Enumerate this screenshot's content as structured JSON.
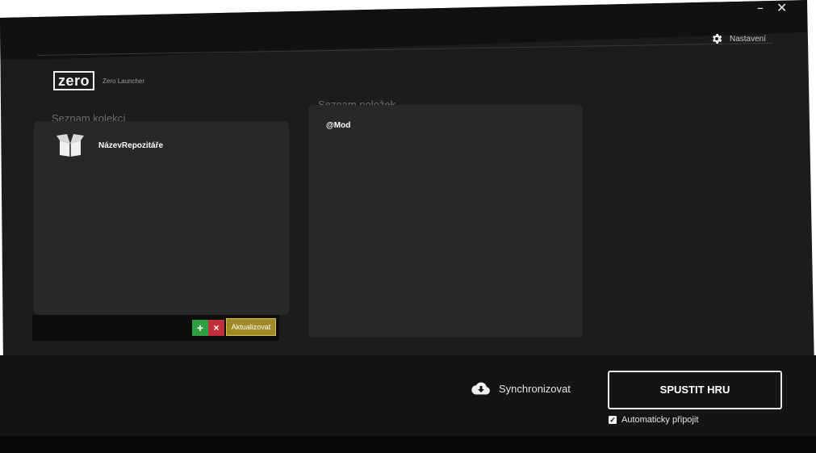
{
  "window": {
    "minimize_glyph": "–",
    "close_glyph": "✕"
  },
  "header": {
    "settings_label": "Nastavení",
    "settings_icon": "gear-icon"
  },
  "logo": {
    "text": "zero",
    "subtitle": "Zero Launcher"
  },
  "collections": {
    "title": "Seznam kolekcí",
    "items": [
      {
        "name": "NázevRepozitáře",
        "icon": "open-box-icon"
      }
    ],
    "toolbar": {
      "add_label": "+",
      "remove_label": "×",
      "update_label": "Aktualizovat"
    }
  },
  "items_panel": {
    "title": "Seznam položek",
    "items": [
      "@Mod"
    ]
  },
  "footer": {
    "sync_label": "Synchronizovat",
    "sync_icon": "cloud-download-icon",
    "play_label": "SPUSTIT HRU",
    "auto_connect_label": "Automaticky připojit",
    "auto_connect_checked": true
  },
  "colors": {
    "background": "#1c1c1e",
    "panel": "#28282b",
    "add": "#2ea043",
    "remove": "#c0303a",
    "update": "#a08a28"
  }
}
